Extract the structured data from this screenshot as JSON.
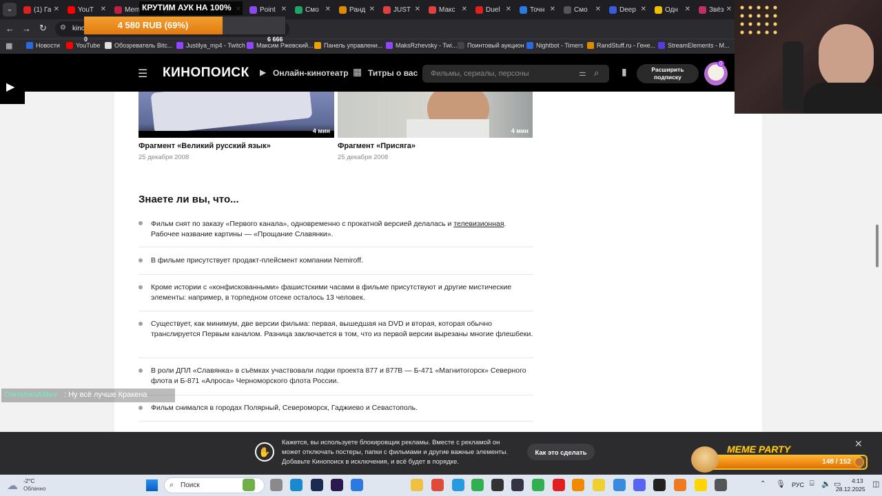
{
  "browser": {
    "tabs": [
      {
        "label": "(1) Га",
        "color": "#e02020"
      },
      {
        "label": "YouT",
        "color": "#ff0000"
      },
      {
        "label": "Mem",
        "color": "#c02040"
      },
      {
        "label": "",
        "color": "#444"
      },
      {
        "label": "Point",
        "color": "#8a4af0"
      },
      {
        "label": "Смо",
        "color": "#1fa463"
      },
      {
        "label": "Ранд",
        "color": "#e08a00"
      },
      {
        "label": "JUST",
        "color": "#e04040"
      },
      {
        "label": "Макс",
        "color": "#e04040"
      },
      {
        "label": "Duel",
        "color": "#e02020"
      },
      {
        "label": "Точн",
        "color": "#2a7ae0"
      },
      {
        "label": "Смо",
        "color": "#555"
      },
      {
        "label": "Deep",
        "color": "#3a5ae0"
      },
      {
        "label": "Одн",
        "color": "#f0c000"
      },
      {
        "label": "Звёз",
        "color": "#c03060"
      }
    ],
    "address": "kino",
    "bookmarks": [
      {
        "label": "Новости",
        "color": "#2a6ae0"
      },
      {
        "label": "YouTube",
        "color": "#ff0000"
      },
      {
        "label": "Обозреватель Bitc...",
        "color": "#e0e0e0"
      },
      {
        "label": "Justilya_mp4 - Twitch",
        "color": "#9146ff"
      },
      {
        "label": "Максим Ржевский...",
        "color": "#9146ff"
      },
      {
        "label": "Панель управлени...",
        "color": "#f0a000"
      },
      {
        "label": "MaksRzhevsky - Twi...",
        "color": "#9146ff"
      },
      {
        "label": "Поинтовый аукцион",
        "color": "#444"
      },
      {
        "label": "Nightbot - Timers",
        "color": "#2a6ae0"
      },
      {
        "label": "RandStuff.ru - Гене...",
        "color": "#e08a00"
      },
      {
        "label": "StreamElements - M...",
        "color": "#5a3ae0"
      }
    ]
  },
  "overlay": {
    "auction_title": "КРУТИМ АУК НА 100%",
    "auction_amount": "4 580 RUB (69%)",
    "auction_progress": 0.69,
    "auction_start": "0",
    "auction_goal": "6 666",
    "chat_user": "ChristianAlliev",
    "chat_message": ": Ну всё лучше Кракена",
    "meme_title": "MEME PARTY",
    "meme_counter": "148 / 152",
    "meme_progress": 0.974
  },
  "kp": {
    "logo": "КИНОПОИСК",
    "nav_online": "Онлайн-кинотеатр",
    "nav_titles": "Титры о вас",
    "search_placeholder": "Фильмы, сериалы, персоны",
    "subscribe": "Расширить подписку",
    "avatar_badge": "0"
  },
  "clips": [
    {
      "title": "Фрагмент «Великий русский язык»",
      "date": "25 декабря 2008",
      "duration": "4 мин"
    },
    {
      "title": "Фрагмент «Присяга»",
      "date": "25 декабря 2008",
      "duration": "4 мин"
    }
  ],
  "trivia": {
    "heading": "Знаете ли вы, что...",
    "facts": [
      {
        "text_before": "Фильм снят по заказу «Первого канала», одновременно с прокатной версией делалась и ",
        "link": "телевизионная",
        "text_after": ". Рабочее название картины — «Прощание Славянки»."
      },
      {
        "text": "В фильме присутствует продакт-плейсмент компании Nemiroff."
      },
      {
        "text": "Кроме истории с «конфискованными» фашистскими часами в фильме присутствуют и другие мистические элементы: например, в торпедном отсеке осталось 13 человек."
      },
      {
        "text": "Существует, как минимум, две версии фильма: первая, вышедшая на DVD и вторая, которая обычно транслируется Первым каналом. Разница заключается в том, что из первой версии вырезаны многие флешбеки."
      },
      {
        "text": "В роли ДПЛ «Славянка» в съёмках участвовали лодки проекта 877 и 877В — Б-471 «Магнитогорск» Северного флота и Б-871 «Алроса» Черноморского флота России."
      },
      {
        "text": "Фильм снимался в городах Полярный, Североморск, Гаджиево и Севастополь."
      }
    ]
  },
  "adblock": {
    "text": "Кажется, вы используете блокировщик рекламы. Вместе с рекламой он может отключать постеры, папки с фильмами и другие важные элементы. Добавьте Кинопоиск в исключения, и всё будет в порядке.",
    "button": "Как это сделать"
  },
  "taskbar": {
    "weather_temp": "-2°C",
    "weather_desc": "Облачно",
    "search": "Поиск",
    "lang": "РУС",
    "time": "4:13",
    "date": "28.12.2025"
  },
  "colors": {
    "accent": "#ff6600",
    "kp_black": "#000000",
    "auction_orange": "#f08a1a"
  }
}
